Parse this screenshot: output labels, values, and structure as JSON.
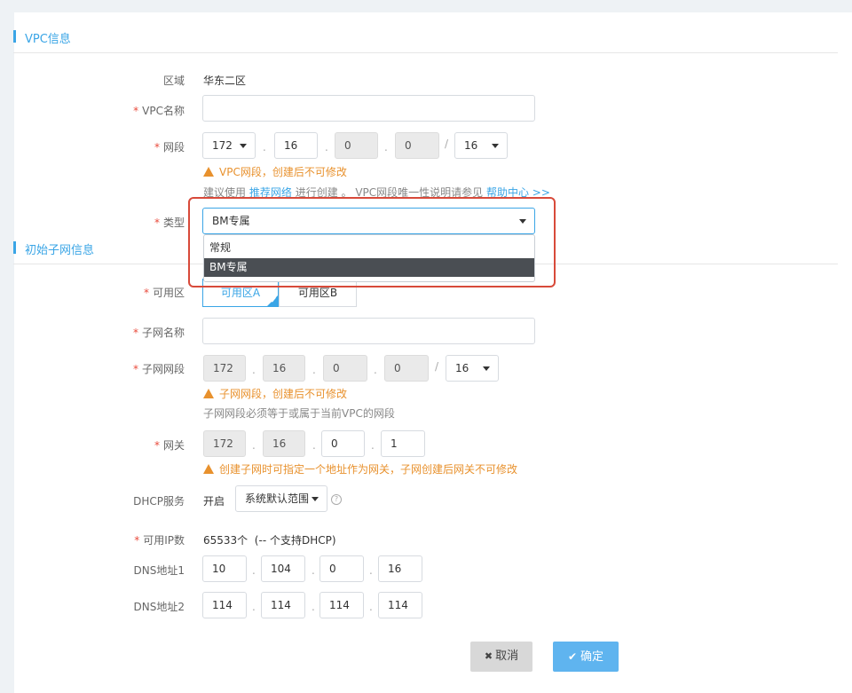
{
  "vpc_section": {
    "title": "VPC信息",
    "region": {
      "label": "区域",
      "value": "华东二区"
    },
    "name": {
      "label": "VPC名称",
      "value": ""
    },
    "cidr": {
      "label": "网段",
      "oct1": "172",
      "oct2": "16",
      "oct3": "0",
      "oct4": "0",
      "mask": "16",
      "sep": "/"
    },
    "warning": "VPC网段，创建后不可修改",
    "tip_prefix": "建议使用",
    "tip_link1": "推荐网络",
    "tip_middle": "进行创建 。 VPC网段唯一性说明请参见",
    "tip_link2": "帮助中心 >>",
    "type": {
      "label": "类型",
      "value": "BM专属",
      "options": [
        "常规",
        "BM专属"
      ]
    }
  },
  "subnet_section": {
    "title": "初始子网信息",
    "zone": {
      "label": "可用区",
      "options": [
        "可用区A",
        "可用区B"
      ]
    },
    "subnet_name": {
      "label": "子网名称",
      "value": ""
    },
    "subnet_cidr": {
      "label": "子网网段",
      "oct1": "172",
      "oct2": "16",
      "oct3": "0",
      "oct4": "0",
      "mask": "16",
      "sep": "/"
    },
    "subnet_warning": "子网网段，创建后不可修改",
    "subnet_tip": "子网网段必须等于或属于当前VPC的网段",
    "gateway": {
      "label": "网关",
      "oct1": "172",
      "oct2": "16",
      "oct3": "0",
      "oct4": "1"
    },
    "gateway_warning": "创建子网时可指定一个地址作为网关，子网创建后网关不可修改",
    "dhcp": {
      "label": "DHCP服务",
      "state": "开启",
      "range": "系统默认范围",
      "help": "?"
    },
    "ip_count": {
      "label": "可用IP数",
      "value": "65533个  (-- 个支持DHCP)"
    },
    "dns1": {
      "label": "DNS地址1",
      "oct1": "10",
      "oct2": "104",
      "oct3": "0",
      "oct4": "16"
    },
    "dns2": {
      "label": "DNS地址2",
      "oct1": "114",
      "oct2": "114",
      "oct3": "114",
      "oct4": "114"
    }
  },
  "footer": {
    "cancel": "取消",
    "cancel_icon": "✖",
    "ok": "确定",
    "ok_icon": "✔"
  },
  "colors": {
    "accent": "#3aa5e6",
    "warning": "#e8912d",
    "required": "#e94b3c",
    "highlight": "#d84a3a"
  }
}
